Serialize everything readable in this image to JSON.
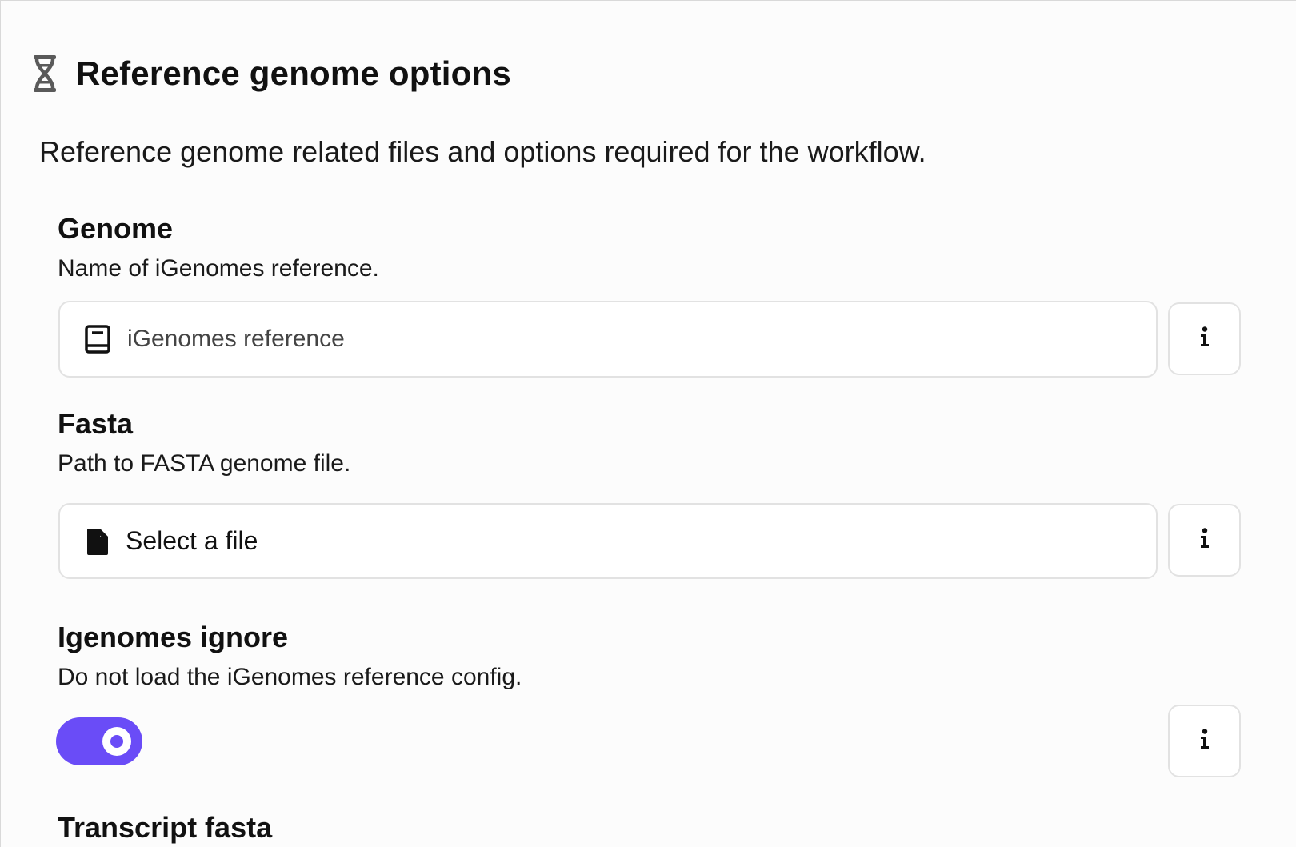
{
  "section": {
    "title": "Reference genome options",
    "description": "Reference genome related files and options required for the workflow.",
    "icon": "dna-icon"
  },
  "fields": {
    "genome": {
      "label": "Genome",
      "help": "Name of iGenomes reference.",
      "placeholder": "iGenomes reference",
      "value": "",
      "icon": "book-icon"
    },
    "fasta": {
      "label": "Fasta",
      "help": "Path to FASTA genome file.",
      "select_label": "Select a file",
      "icon": "file-icon"
    },
    "igenomes_ignore": {
      "label": "Igenomes ignore",
      "help": "Do not load the iGenomes reference config.",
      "enabled": true
    },
    "transcript_fasta": {
      "label": "Transcript fasta"
    }
  },
  "info_button": {
    "icon": "info-icon"
  },
  "colors": {
    "accent": "#6a4cf7",
    "border": "#e2e2e2",
    "background": "#fcfcfc"
  }
}
